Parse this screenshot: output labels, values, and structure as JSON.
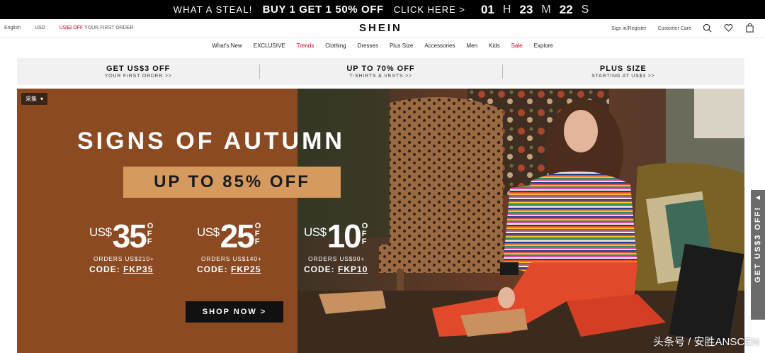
{
  "promo_bar": {
    "steal": "WHAT A STEAL!",
    "offer": "BUY 1 GET 1 50% OFF",
    "click": "CLICK HERE >",
    "countdown": [
      {
        "value": "01",
        "unit": "H"
      },
      {
        "value": "23",
        "unit": "M"
      },
      {
        "value": "22",
        "unit": "S"
      }
    ]
  },
  "header": {
    "language": "English",
    "currency": "USD",
    "promo_red": "US$3 OFF",
    "promo_text": "YOUR FIRST ORDER",
    "logo": "SHEIN",
    "sign_in": "Sign in/Register",
    "customer_care": "Customer Care",
    "icons": [
      "search-icon",
      "heart-icon",
      "bag-icon"
    ]
  },
  "nav": {
    "items": [
      {
        "label": "What's New",
        "highlight": false
      },
      {
        "label": "EXCLUSIVE",
        "highlight": false
      },
      {
        "label": "Trends",
        "highlight": true
      },
      {
        "label": "Clothing",
        "highlight": false
      },
      {
        "label": "Dresses",
        "highlight": false
      },
      {
        "label": "Plus Size",
        "highlight": false
      },
      {
        "label": "Accessories",
        "highlight": false
      },
      {
        "label": "Men",
        "highlight": false
      },
      {
        "label": "Kids",
        "highlight": false
      },
      {
        "label": "Sale",
        "highlight": true
      },
      {
        "label": "Explore",
        "highlight": false
      }
    ],
    "highlight_color": "#d0021b"
  },
  "promo_strip": [
    {
      "title": "GET US$3 OFF",
      "sub": "YOUR FIRST ORDER >>"
    },
    {
      "title": "UP TO 70% OFF",
      "sub": "T-SHIRTS & VESTS >>"
    },
    {
      "title": "PLUS SIZE",
      "sub": "STARTING AT US$3 >>"
    }
  ],
  "hero": {
    "caiji": "采集",
    "title": "SIGNS OF AUTUMN",
    "subtitle": "UP TO 85% OFF",
    "offers": [
      {
        "currency": "US$",
        "amount": "35",
        "of1": "O",
        "of2": "F",
        "of3": "F",
        "orders": "ORDERS US$210+",
        "code_label": "CODE:",
        "code": "FKP35"
      },
      {
        "currency": "US$",
        "amount": "25",
        "of1": "O",
        "of2": "F",
        "of3": "F",
        "orders": "ORDERS US$140+",
        "code_label": "CODE:",
        "code": "FKP25"
      },
      {
        "currency": "US$",
        "amount": "10",
        "of1": "O",
        "of2": "F",
        "of3": "F",
        "orders": "ORDERS US$90+",
        "code_label": "CODE:",
        "code": "FKP10"
      }
    ],
    "shop_now": "SHOP NOW >",
    "left_bg": "#8b4a22",
    "box_color": "#d69a5e"
  },
  "side_tab": {
    "label": "GET US$3 OFF!",
    "arrow": "◀"
  },
  "watermark": "头条号 / 安胜ANSCEN"
}
